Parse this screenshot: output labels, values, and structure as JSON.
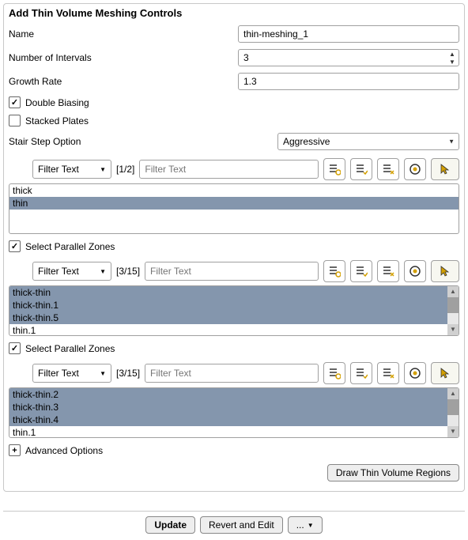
{
  "title": "Add Thin Volume Meshing Controls",
  "fields": {
    "name_label": "Name",
    "name_value": "thin-meshing_1",
    "intervals_label": "Number of Intervals",
    "intervals_value": "3",
    "growth_label": "Growth Rate",
    "growth_value": "1.3",
    "double_biasing_label": "Double Biasing",
    "stacked_plates_label": "Stacked Plates",
    "stair_label": "Stair Step Option",
    "stair_value": "Aggressive"
  },
  "filter": {
    "dropdown_label": "Filter Text",
    "placeholder": "Filter Text"
  },
  "section1": {
    "count": "[1/2]",
    "items": [
      {
        "text": "thick",
        "selected": false
      },
      {
        "text": "thin",
        "selected": true
      }
    ]
  },
  "parallel_zones_label": "Select Parallel Zones",
  "section2": {
    "count": "[3/15]",
    "items": [
      {
        "text": "thick-thin",
        "selected": true
      },
      {
        "text": "thick-thin.1",
        "selected": true
      },
      {
        "text": "thick-thin.5",
        "selected": true
      },
      {
        "text": "thin.1",
        "selected": false
      }
    ]
  },
  "section3": {
    "count": "[3/15]",
    "items": [
      {
        "text": "thick-thin.2",
        "selected": true
      },
      {
        "text": "thick-thin.3",
        "selected": true
      },
      {
        "text": "thick-thin.4",
        "selected": true
      },
      {
        "text": "thin.1",
        "selected": false
      }
    ]
  },
  "advanced_label": "Advanced Options",
  "draw_button": "Draw Thin Volume Regions",
  "buttons": {
    "update": "Update",
    "revert": "Revert and Edit",
    "more": "..."
  }
}
